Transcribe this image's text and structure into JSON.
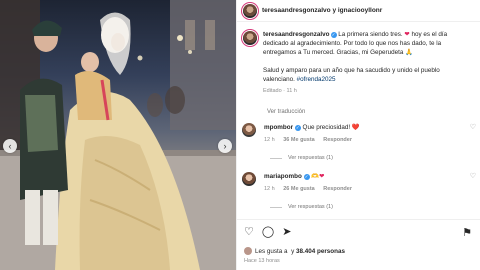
{
  "header": {
    "title": "teresaandresgonzalvo y ignaciooyllonr"
  },
  "caption": {
    "username": "teresaandresgonzalvo",
    "text_part1": "La primera siendo tres.",
    "heart": "❤",
    "text_part2": "hoy es el día dedicado al agradecimiento. Por todo lo que nos has dado, te la entregamos a Tu merced. Gracias, mi Geperudeta",
    "hands": "🙏",
    "paragraph2": "Salud y amparo para un año que ha sacudido y unido el pueblo valenciano.",
    "hashtag": "#ofrenda2025",
    "edited": "Editado · 11 h"
  },
  "translation": {
    "label": "Ver traducción"
  },
  "comments": [
    {
      "username": "mpombor",
      "text": "Que preciosidad!",
      "emoji": "❤️",
      "time": "12 h",
      "likes": "36 Me gusta",
      "reply": "Responder",
      "replies_label": "Ver respuestas (1)"
    },
    {
      "username": "mariapombo",
      "text": "",
      "emoji": "🫶❤",
      "time": "12 h",
      "likes": "26 Me gusta",
      "reply": "Responder",
      "replies_label": "Ver respuestas (1)"
    }
  ],
  "footer": {
    "likes_prefix": "Les gusta a",
    "likes_names": "",
    "likes_conj": "y",
    "likes_count": "38.404 personas",
    "time_ago": "Hace 13 horas"
  },
  "icons": {
    "like": "heart-outline-icon",
    "comment": "comment-icon",
    "share": "share-icon",
    "save": "bookmark-icon",
    "prev": "chevron-left-icon",
    "next": "chevron-right-icon"
  },
  "colors": {
    "accent_blue": "#3897f0",
    "heart_red": "#e0245e",
    "hashtag": "#00376b",
    "muted": "#8e8e8e"
  }
}
